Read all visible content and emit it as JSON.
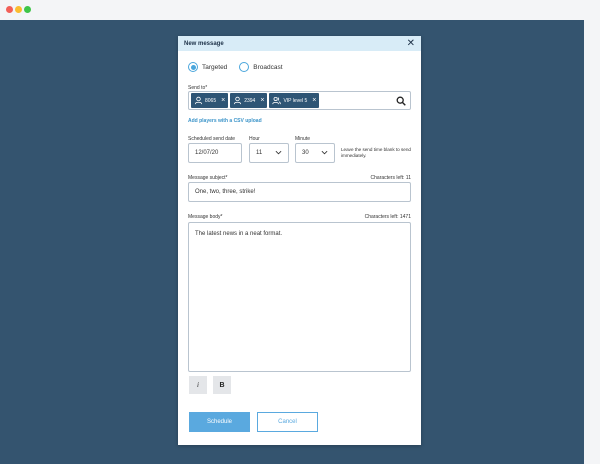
{
  "modal": {
    "title": "New message"
  },
  "audience": {
    "options": [
      {
        "label": "Targeted",
        "selected": true
      },
      {
        "label": "Broadcast",
        "selected": false
      }
    ]
  },
  "send_to": {
    "label": "Send to*",
    "chips": [
      {
        "label": "8065",
        "icon": "user-icon"
      },
      {
        "label": "2394",
        "icon": "user-icon"
      },
      {
        "label": "VIP level 5",
        "icon": "users-group-icon"
      }
    ],
    "csv_link": "Add players with a CSV upload"
  },
  "schedule": {
    "date_label": "Scheduled send date",
    "date_value": "12/07/20",
    "hour_label": "Hour",
    "hour_value": "11",
    "minute_label": "Minute",
    "minute_value": "30",
    "hint": "Leave the send time blank to send immediately."
  },
  "subject": {
    "label": "Message subject*",
    "chars_left": "Characters left: 11",
    "value": "One, two, three, strike!"
  },
  "body": {
    "label": "Message body*",
    "chars_left": "Characters left: 1471",
    "value": "The latest news in a neat format."
  },
  "format_buttons": {
    "italic": "i",
    "bold": "B"
  },
  "actions": {
    "schedule": "Schedule",
    "cancel": "Cancel"
  },
  "colors": {
    "backdrop": "#34546f",
    "chip": "#2e5575",
    "accent": "#5aa9df",
    "header": "#d8ecf7"
  }
}
